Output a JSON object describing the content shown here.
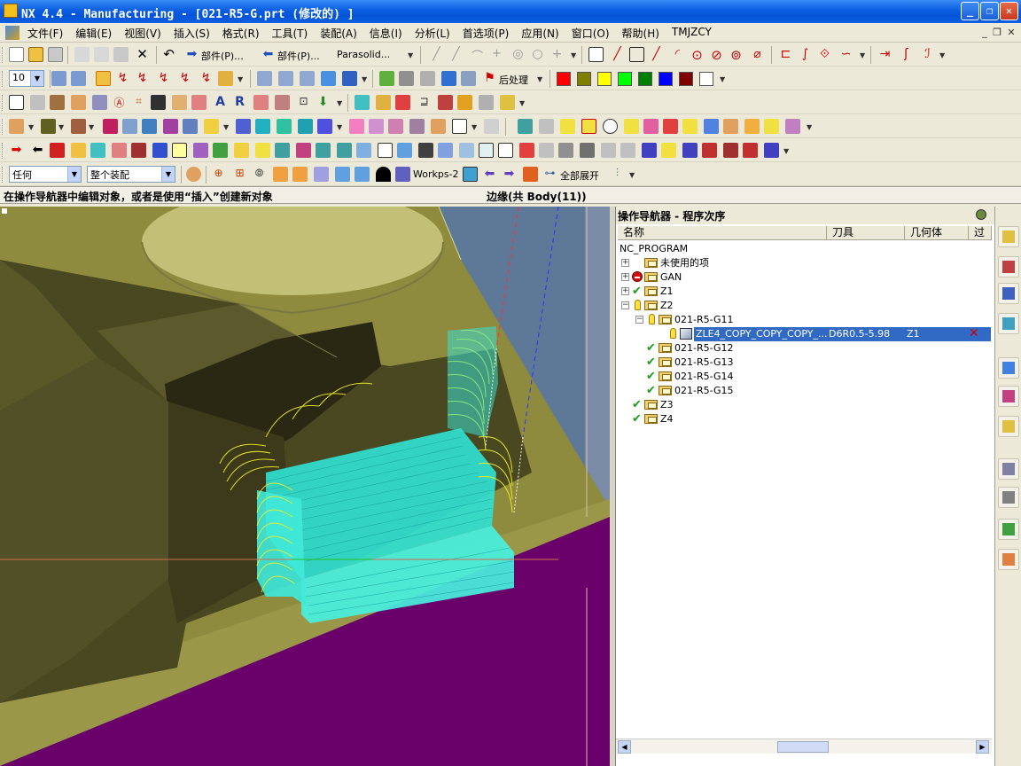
{
  "window": {
    "title": "NX 4.4 - Manufacturing - [021-R5-G.prt  (修改的) ]",
    "min_icon": "minimize-icon",
    "max_icon": "maximize-icon",
    "close_icon": "close-icon"
  },
  "menu": [
    "文件(F)",
    "编辑(E)",
    "视图(V)",
    "插入(S)",
    "格式(R)",
    "工具(T)",
    "装配(A)",
    "信息(I)",
    "分析(L)",
    "首选项(P)",
    "应用(N)",
    "窗口(O)",
    "帮助(H)",
    "TMJZCY"
  ],
  "toolbar": {
    "part_label_1": "部件(P)...",
    "part_label_2": "部件(P)...",
    "parasolid_label": "Parasolid...",
    "postprocess_label": "后处理",
    "size_combo_value": "10",
    "filter_combo_value": "任何",
    "assembly_combo_value": "整个装配",
    "workpart_label": "Workps-2",
    "expand_all_label": "全部展开",
    "colors": [
      "#ff0000",
      "#808000",
      "#ffff00",
      "#00ff00",
      "#008000",
      "#0000ff",
      "#800000",
      "#ffffff"
    ]
  },
  "cue": {
    "prompt": "在操作导航器中编辑对象，或者是使用“插入”创建新对象",
    "status": "边缘(共 Body(11))"
  },
  "navigator": {
    "title": "操作导航器 - 程序次序",
    "columns": [
      "名称",
      "刀具",
      "几何体",
      "过切"
    ],
    "root": "NC_PROGRAM",
    "items": [
      {
        "label": "未使用的项",
        "level": 1,
        "state": "none",
        "expander": "+"
      },
      {
        "label": "GAN",
        "level": 1,
        "state": "noentry",
        "expander": "+"
      },
      {
        "label": "Z1",
        "level": 1,
        "state": "check",
        "expander": "+"
      },
      {
        "label": "Z2",
        "level": 1,
        "state": "bulb",
        "expander": "−"
      },
      {
        "label": "021-R5-G11",
        "level": 2,
        "state": "bulb",
        "expander": "−"
      },
      {
        "label": "ZLE4_COPY_COPY_COPY_...",
        "level": 3,
        "state": "bulb",
        "tool": "D6R0.5-5.98",
        "geometry": "Z1",
        "selected": true
      },
      {
        "label": "021-R5-G12",
        "level": 2,
        "state": "check"
      },
      {
        "label": "021-R5-G13",
        "level": 2,
        "state": "check"
      },
      {
        "label": "021-R5-G14",
        "level": 2,
        "state": "check"
      },
      {
        "label": "021-R5-G15",
        "level": 2,
        "state": "check"
      },
      {
        "label": "Z3",
        "level": 1,
        "state": "check"
      },
      {
        "label": "Z4",
        "level": 1,
        "state": "check"
      }
    ]
  },
  "resource_bar_icons": [
    "assembly-navigator-icon",
    "part-navigator-icon",
    "operation-navigator-icon",
    "machine-tool-navigator-icon",
    "web-browser-icon",
    "palette-icon",
    "help-icon",
    "history-icon",
    "system-materials-icon",
    "roles-icon",
    "user-icon"
  ]
}
